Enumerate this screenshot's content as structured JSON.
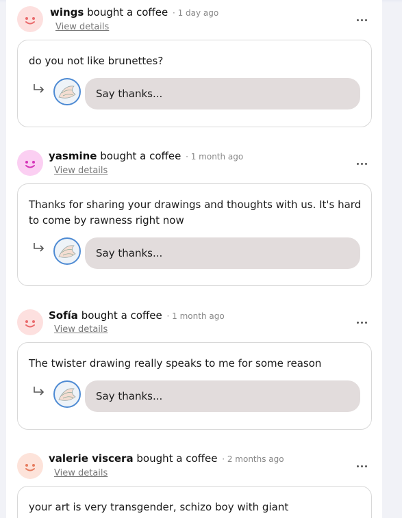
{
  "feed": {
    "items": [
      {
        "name": "wings",
        "action": "bought a coffee",
        "ago": "· 1 day ago",
        "view_details": "View details",
        "message": "do you not like brunettes?",
        "reply_placeholder": "Say thanks...",
        "avatar_color": "#fde0df",
        "face_color": "#ea6a6c"
      },
      {
        "name": "yasmine",
        "action": "bought a coffee",
        "ago": "· 1 month ago",
        "view_details": "View details",
        "message": "Thanks for sharing your drawings and thoughts with us. It's hard to come by rawness right now",
        "reply_placeholder": "Say thanks...",
        "avatar_color": "#fbcff2",
        "face_color": "#d534b8"
      },
      {
        "name": "Sofía",
        "action": "bought a coffee",
        "ago": "· 1 month ago",
        "view_details": "View details",
        "message": "The twister drawing really speaks to me for some reason",
        "reply_placeholder": "Say thanks...",
        "avatar_color": "#fde0df",
        "face_color": "#ea6a6c"
      },
      {
        "name": "valerie viscera",
        "action": "bought a coffee",
        "ago": "· 2 months ago",
        "view_details": "View details",
        "message": "your art is very transgender, schizo boy with giant",
        "avatar_color": "#fde3da",
        "face_color": "#e67c5f"
      }
    ]
  },
  "icons": {
    "more": "more-options-icon",
    "reply": "reply-arrow-icon",
    "face": "smiley-face-icon",
    "creator_avatar": "creator-avatar"
  }
}
